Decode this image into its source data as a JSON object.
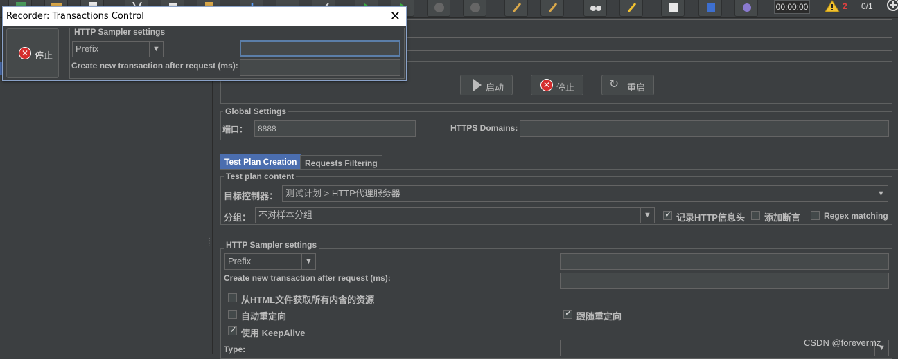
{
  "toolbar": {
    "timer": "00:00:00",
    "warning_count": "2",
    "thread_count": "0/1"
  },
  "dialog": {
    "title": "Recorder: Transactions Control",
    "stop_label": "停止",
    "group_title": "HTTP Sampler settings",
    "naming_scheme_value": "Prefix",
    "create_tx_label": "Create new transaction after request (ms):",
    "prefix_value": "",
    "create_tx_value": ""
  },
  "controls": {
    "start_label": "启动",
    "stop_label": "停止",
    "restart_label": "重启"
  },
  "global_settings": {
    "title": "Global Settings",
    "port_label": "端口：",
    "port_value": "8888",
    "https_domains_label": "HTTPS Domains:",
    "https_domains_value": ""
  },
  "tabs": [
    {
      "label": "Test Plan Creation",
      "active": true
    },
    {
      "label": "Requests Filtering",
      "active": false
    }
  ],
  "test_plan_content": {
    "title": "Test plan content",
    "target_controller_label": "目标控制器：",
    "target_controller_value": "测试计划 > HTTP代理服务器",
    "grouping_label": "分组：",
    "grouping_value": "不对样本分组",
    "record_headers_label": "记录HTTP信息头",
    "record_headers_checked": true,
    "add_assertions_label": "添加断言",
    "add_assertions_checked": false,
    "regex_matching_label": "Regex matching",
    "regex_matching_checked": false
  },
  "http_sampler_settings": {
    "title": "HTTP Sampler settings",
    "naming_scheme_value": "Prefix",
    "prefix_value": "",
    "create_tx_label": "Create new transaction after request (ms):",
    "create_tx_value": "",
    "retrieve_embedded_label": "从HTML文件获取所有内含的资源",
    "retrieve_embedded_checked": false,
    "auto_redirect_label": "自动重定向",
    "auto_redirect_checked": false,
    "follow_redirects_label": "跟随重定向",
    "follow_redirects_checked": true,
    "keepalive_label": "使用 KeepAlive",
    "keepalive_checked": true,
    "type_label": "Type:",
    "type_value": ""
  },
  "watermark": "CSDN @forevermz",
  "colors": {
    "background": "#3c3f41",
    "active_tab": "#4b6eaf",
    "stop_red": "#d42d2d",
    "warning_red": "#e04040"
  }
}
